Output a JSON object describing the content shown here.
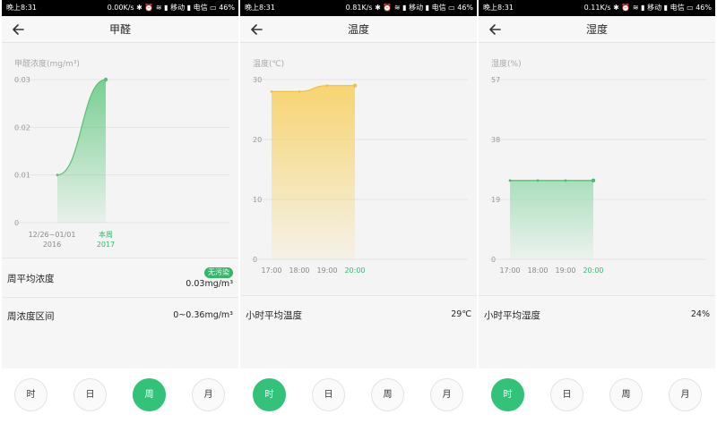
{
  "panels": [
    {
      "status": {
        "time": "晚上8:31",
        "right": "0.00K/s ✱ ⏰ ≋ ▮ 移动 ▮ 电信 ▭ 46%"
      },
      "title": "甲醛",
      "axis_title": "甲醛浓度(mg/m³)",
      "x_labels": [
        [
          "12/26~01/01",
          "2016"
        ],
        [
          "本周",
          "2017"
        ]
      ],
      "highlight_index": 1,
      "summary": [
        {
          "label": "周平均浓度",
          "value": "0.03mg/m³",
          "badge": "无污染"
        },
        {
          "label": "周浓度区间",
          "value": "0~0.36mg/m³"
        }
      ],
      "tabs": [
        "时",
        "日",
        "周",
        "月"
      ],
      "active_tab": 2,
      "colors": {
        "stroke": "#5dbf72",
        "fill": "#63c982"
      }
    },
    {
      "status": {
        "time": "晚上8:31",
        "right": "0.81K/s ✱ ⏰ ≋ ▮ 移动 ▮ 电信 ▭ 46%"
      },
      "title": "温度",
      "axis_title": "温度(℃)",
      "x_labels": [
        [
          "17:00"
        ],
        [
          "18:00"
        ],
        [
          "19:00"
        ],
        [
          "20:00"
        ]
      ],
      "highlight_index": 3,
      "summary": [
        {
          "label": "小时平均温度",
          "value": "29℃"
        }
      ],
      "tabs": [
        "时",
        "日",
        "周",
        "月"
      ],
      "active_tab": 0,
      "colors": {
        "stroke": "#f2c046",
        "fill": "#f8cf5a"
      }
    },
    {
      "status": {
        "time": "晚上8:31",
        "right": "0.11K/s ✱ ⏰ ≋ ▮ 移动 ▮ 电信 ▭ 46%"
      },
      "title": "湿度",
      "axis_title": "湿度(%)",
      "x_labels": [
        [
          "17:00"
        ],
        [
          "18:00"
        ],
        [
          "19:00"
        ],
        [
          "20:00"
        ]
      ],
      "highlight_index": 3,
      "summary": [
        {
          "label": "小时平均湿度",
          "value": "24%"
        }
      ],
      "tabs": [
        "时",
        "日",
        "周",
        "月"
      ],
      "active_tab": 0,
      "colors": {
        "stroke": "#4cb96d",
        "fill": "#9ddbb3"
      }
    }
  ],
  "highlight_color": "#2fba6e",
  "chart_data": [
    {
      "type": "area",
      "ylim": [
        0,
        0.03
      ],
      "yticks": [
        "0",
        "0.01",
        "0.02",
        "0.03"
      ],
      "ytick_values": [
        0,
        0.01,
        0.02,
        0.03
      ],
      "x": [
        "12/26~01/01 2016",
        "本周 2017"
      ],
      "values": [
        0.01,
        0.03
      ],
      "ylabel": "甲醛浓度(mg/m³)"
    },
    {
      "type": "area",
      "ylim": [
        0,
        30
      ],
      "yticks": [
        "0",
        "10",
        "20",
        "30"
      ],
      "ytick_values": [
        0,
        10,
        20,
        30
      ],
      "x": [
        "17:00",
        "18:00",
        "19:00",
        "20:00"
      ],
      "values": [
        28,
        28,
        29,
        29
      ],
      "ylabel": "温度(℃)"
    },
    {
      "type": "area",
      "ylim": [
        0,
        57
      ],
      "yticks": [
        "0",
        "19",
        "38",
        "57"
      ],
      "ytick_values": [
        0,
        19,
        38,
        57
      ],
      "x": [
        "17:00",
        "18:00",
        "19:00",
        "20:00"
      ],
      "values": [
        25,
        25,
        25,
        25
      ],
      "ylabel": "湿度(%)"
    }
  ]
}
